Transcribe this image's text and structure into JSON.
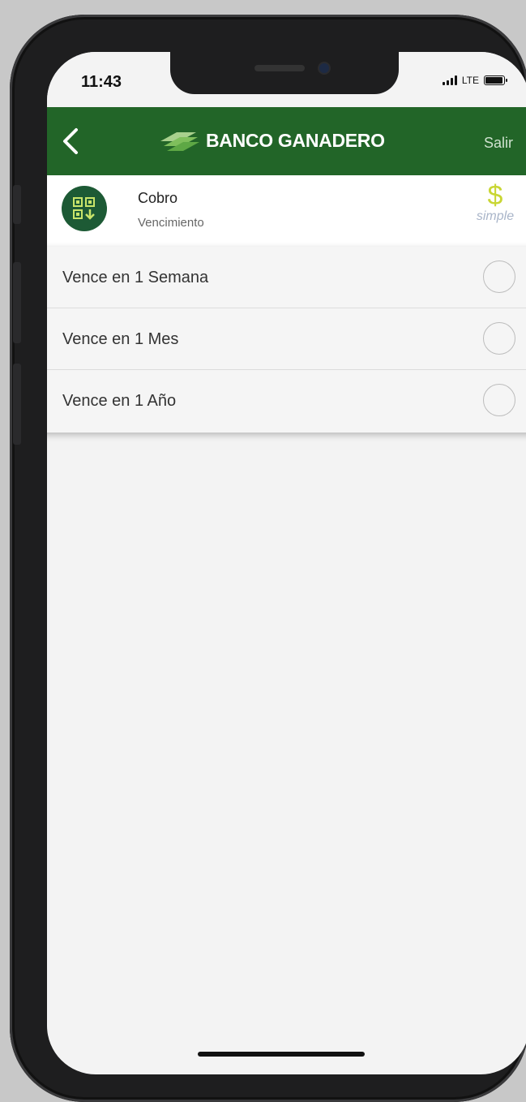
{
  "status_bar": {
    "time": "11:43",
    "network": "LTE"
  },
  "navbar": {
    "brand": "BANCO GANADERO",
    "exit_label": "Salir",
    "color": "#226528"
  },
  "header": {
    "title": "Cobro",
    "subtitle": "Vencimiento",
    "logo_symbol": "$",
    "logo_word": "simple"
  },
  "options": [
    {
      "label": "Vence en 1 Semana",
      "selected": false
    },
    {
      "label": "Vence en 1 Mes",
      "selected": false
    },
    {
      "label": "Vence en 1 Año",
      "selected": false
    }
  ]
}
